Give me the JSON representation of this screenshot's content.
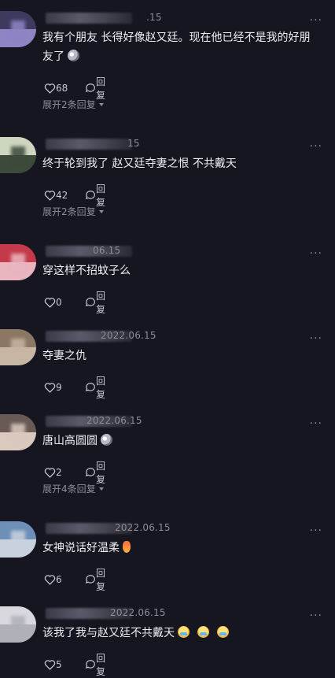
{
  "comments": [
    {
      "date": "2022.06.15",
      "date_visible": ".15",
      "text": "我有个朋友 长得好像赵又廷。现在他已经不是我的好朋友了",
      "emoji": "cat",
      "likes": "68",
      "reply_label": "回复",
      "expand_label": "展开2条回复",
      "avatar_colors": [
        "#3c3a5e",
        "#8f84c4"
      ]
    },
    {
      "date": "2022.06.15",
      "date_visible": "15",
      "text": "终于轮到我了 赵又廷夺妻之恨 不共戴天",
      "likes": "42",
      "reply_label": "回复",
      "expand_label": "展开2条回复",
      "avatar_colors": [
        "#cfd6c0",
        "#3d4a3a"
      ]
    },
    {
      "date": "2022.06.15",
      "date_visible": "06.15",
      "text": "穿这样不招蚊子么",
      "likes": "0",
      "reply_label": "回复",
      "avatar_colors": [
        "#c43a4a",
        "#e9b5bf"
      ]
    },
    {
      "date": "2022.06.15",
      "date_visible": "2022.06.15",
      "text": "夺妻之仇",
      "likes": "9",
      "reply_label": "回复",
      "avatar_colors": [
        "#8c7664",
        "#c7b6a2"
      ]
    },
    {
      "date": "2022.06.15",
      "date_visible": "2022.06.15",
      "text": "唐山高圆圆",
      "emoji": "cat",
      "likes": "2",
      "reply_label": "回复",
      "expand_label": "展开4条回复",
      "avatar_colors": [
        "#6a5a55",
        "#d9c9be"
      ]
    },
    {
      "date": "2022.06.15",
      "date_visible": "2022.06.15",
      "text": "女神说话好温柔",
      "emoji": "fire",
      "likes": "6",
      "reply_label": "回复",
      "avatar_colors": [
        "#6d8fb8",
        "#c8d2de"
      ]
    },
    {
      "date": "2022.06.15",
      "date_visible": "2022.06.15",
      "text": "该我了我与赵又廷不共戴天",
      "emoji": "cry",
      "emoji_count": 3,
      "likes": "5",
      "reply_label": "回复",
      "avatar_colors": [
        "#d8d8de",
        "#b0b0b8"
      ]
    }
  ],
  "icons": {
    "like": "heart-icon",
    "reply": "reply-bubble-icon",
    "more": "more-icon"
  },
  "colors": {
    "background": "#161621",
    "text": "#ededf2",
    "muted": "#8d8d99"
  }
}
